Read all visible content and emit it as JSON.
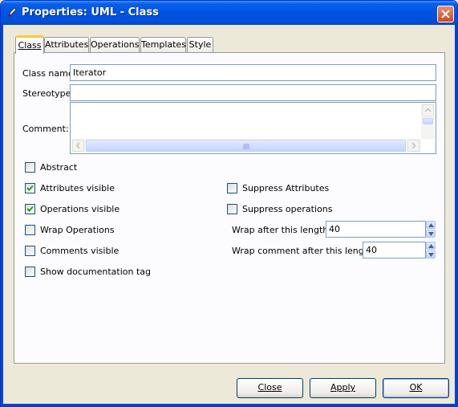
{
  "window": {
    "title": "Properties: UML - Class",
    "icon": "dia-pen-icon"
  },
  "tabs": [
    {
      "label": "Class",
      "active": true
    },
    {
      "label": "Attributes",
      "active": false
    },
    {
      "label": "Operations",
      "active": false
    },
    {
      "label": "Templates",
      "active": false
    },
    {
      "label": "Style",
      "active": false
    }
  ],
  "form": {
    "class_name_label": "Class name:",
    "class_name_value": "Iterator",
    "stereotype_label": "Stereotype:",
    "stereotype_value": "",
    "comment_label": "Comment:",
    "comment_value": ""
  },
  "checkboxes_left": [
    {
      "label": "Abstract",
      "checked": false
    },
    {
      "label": "Attributes visible",
      "checked": true
    },
    {
      "label": "Operations visible",
      "checked": true
    },
    {
      "label": "Wrap Operations",
      "checked": false
    },
    {
      "label": "Comments visible",
      "checked": false
    },
    {
      "label": "Show documentation tag",
      "checked": false
    }
  ],
  "checkboxes_right": [
    {
      "label": "Suppress Attributes",
      "checked": false
    },
    {
      "label": "Suppress operations",
      "checked": false
    }
  ],
  "spinners": [
    {
      "label": "Wrap after this length:",
      "value": "40"
    },
    {
      "label": "Wrap comment after this length:",
      "value": "40"
    }
  ],
  "buttons": {
    "close": "Close",
    "apply": "Apply",
    "ok": "OK"
  },
  "colors": {
    "titlebar": "#0054e3",
    "tab_highlight": "#ffc83c",
    "checkmark": "#21a121"
  }
}
